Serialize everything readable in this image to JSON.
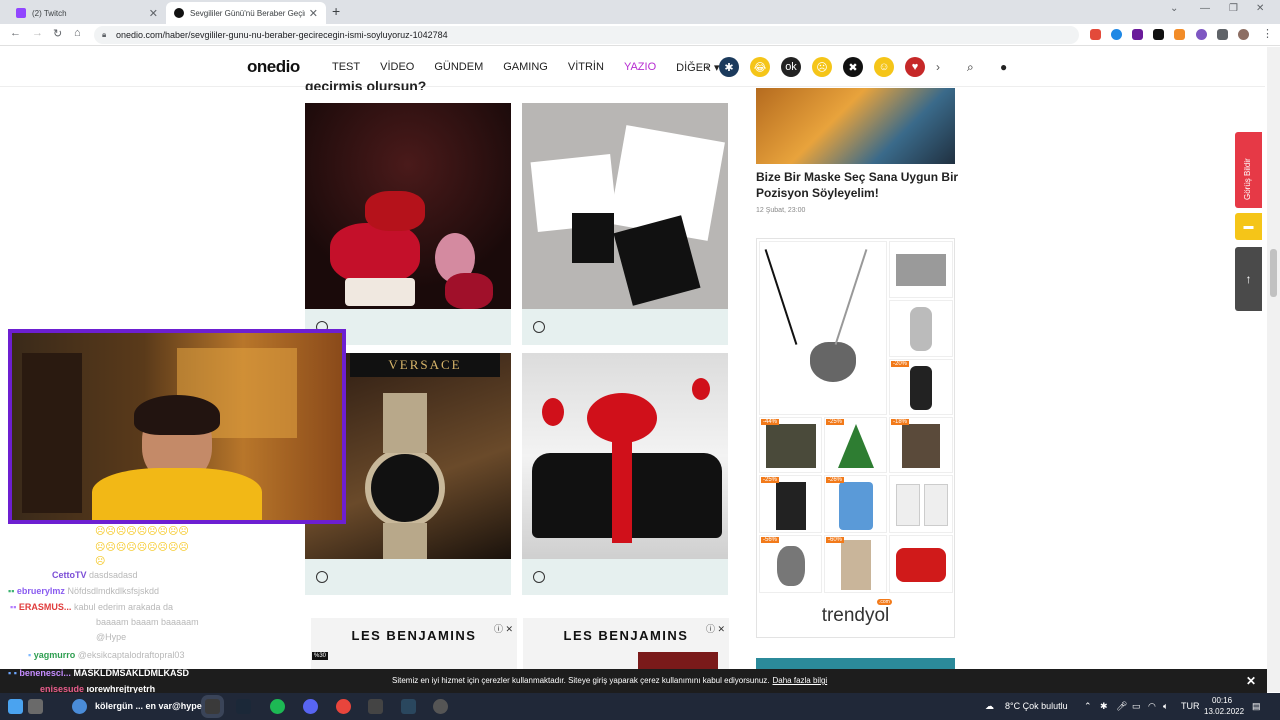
{
  "browser": {
    "tabs": [
      {
        "title": "(2) Twitch"
      },
      {
        "title": "Sevgililer Günü'nü Beraber Geçir..."
      }
    ],
    "url": "onedio.com/haber/sevgililer-gunu-nu-beraber-gecirecegin-ismi-soyluyoruz-1042784"
  },
  "site": {
    "logo": "onedio",
    "menu": [
      "TEST",
      "VİDEO",
      "GÜNDEM",
      "GAMING",
      "VİTRİN",
      "YAZIO",
      "DİĞER ▾"
    ],
    "partial_heading": "geçirmiş olursun?"
  },
  "right": {
    "article_title": "Bize Bir Maske Seç Sana Uygun Bir Pozisyon Söyleyelim!",
    "article_date": "12 Şubat, 23:00",
    "ad_discounts": [
      "-20%",
      "-44%",
      "-25%",
      "-18%",
      "-25%",
      "-26%",
      "-56%",
      "-60%"
    ],
    "ad_brand": "trendyol"
  },
  "ads": {
    "brand1": "LES BENJAMINS",
    "brand2": "LES BENJAMINS",
    "badge": "%30"
  },
  "side": {
    "feedback": "Görüş Bildir"
  },
  "chat": [
    {
      "name": "CettoTV",
      "msg": "dasdsadasd",
      "color": "#7b4dd6"
    },
    {
      "name": "ebrueryImz",
      "msg": "Nöfdsdlmdkdlksfsjskdd",
      "color": "#8a5cf0"
    },
    {
      "name": "ERASMUS...",
      "msg": "kabul ederim arakada da",
      "color": "#e03b3b"
    },
    {
      "name": "",
      "msg": "baaaam baaam baaaaam",
      "color": "#fff"
    },
    {
      "name": "",
      "msg": "@Hype",
      "color": "#fff"
    },
    {
      "name": "yagmurro",
      "msg": "@eksikcaptalodraftopral03",
      "color": "#2e9e50"
    }
  ],
  "chat_over": [
    {
      "name": "benenesci...",
      "msg": "MASKLDMSAKLDMLKASD",
      "color": "#c58cff"
    },
    {
      "name": "enisesude",
      "msg": "ıorewhrejtryetrh",
      "color": "#e85c8a"
    },
    {
      "name": "",
      "msg": "kölergün ... en var@hype",
      "color": "#ff8c00"
    }
  ],
  "cookie": {
    "text": "Sitemiz en iyi hizmet için çerezler kullanmaktadır. Siteye giriş yaparak çerez kullanımını kabul ediyorsunuz.",
    "link": "Daha fazla bilgi",
    "close": "✕"
  },
  "taskbar": {
    "weather": "8°C  Çok bulutlu",
    "lang": "TUR",
    "time": "00:16",
    "date": "13.02.2022"
  }
}
